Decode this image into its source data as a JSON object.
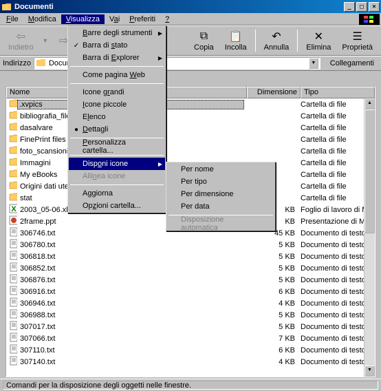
{
  "title": "Documenti",
  "menus": [
    "File",
    "Modifica",
    "Visualizza",
    "Vai",
    "Preferiti",
    "?"
  ],
  "toolbar": {
    "back": "Indietro",
    "copy": "Copia",
    "paste": "Incolla",
    "undo": "Annulla",
    "delete": "Elimina",
    "props": "Proprietà"
  },
  "addressbar": {
    "label": "Indirizzo",
    "value": "Documenti",
    "links": "Collegamenti"
  },
  "columns": {
    "name": "Nome",
    "size": "Dimensione",
    "type": "Tipo"
  },
  "rows": [
    {
      "icon": "folder",
      "name": ".xvpics",
      "size": "",
      "type": "Cartella di file",
      "sel": true
    },
    {
      "icon": "folder",
      "name": "bibliografia_file",
      "size": "",
      "type": "Cartella di file"
    },
    {
      "icon": "folder",
      "name": "dasalvare",
      "size": "",
      "type": "Cartella di file"
    },
    {
      "icon": "folder",
      "name": "FinePrint files",
      "size": "",
      "type": "Cartella di file"
    },
    {
      "icon": "folder",
      "name": "foto_scansioni",
      "size": "",
      "type": "Cartella di file"
    },
    {
      "icon": "folder",
      "name": "Immagini",
      "size": "",
      "type": "Cartella di file"
    },
    {
      "icon": "folder",
      "name": "My eBooks",
      "size": "",
      "type": "Cartella di file"
    },
    {
      "icon": "folder",
      "name": "Origini dati ute",
      "size": "",
      "type": "Cartella di file"
    },
    {
      "icon": "folder",
      "name": "stat",
      "size": "",
      "type": "Cartella di file"
    },
    {
      "icon": "xls",
      "name": "2003_05-06.xl",
      "size": "KB",
      "type": "Foglio di lavoro di Mi..."
    },
    {
      "icon": "ppt",
      "name": "2frame.ppt",
      "size": "KB",
      "type": "Presentazione di Mic..."
    },
    {
      "icon": "txt",
      "name": "306746.txt",
      "size": "45 KB",
      "type": "Documento di testo"
    },
    {
      "icon": "txt",
      "name": "306780.txt",
      "size": "5 KB",
      "type": "Documento di testo"
    },
    {
      "icon": "txt",
      "name": "306818.txt",
      "size": "5 KB",
      "type": "Documento di testo"
    },
    {
      "icon": "txt",
      "name": "306852.txt",
      "size": "5 KB",
      "type": "Documento di testo"
    },
    {
      "icon": "txt",
      "name": "306876.txt",
      "size": "5 KB",
      "type": "Documento di testo"
    },
    {
      "icon": "txt",
      "name": "306916.txt",
      "size": "6 KB",
      "type": "Documento di testo"
    },
    {
      "icon": "txt",
      "name": "306946.txt",
      "size": "4 KB",
      "type": "Documento di testo"
    },
    {
      "icon": "txt",
      "name": "306988.txt",
      "size": "5 KB",
      "type": "Documento di testo"
    },
    {
      "icon": "txt",
      "name": "307017.txt",
      "size": "5 KB",
      "type": "Documento di testo"
    },
    {
      "icon": "txt",
      "name": "307066.txt",
      "size": "7 KB",
      "type": "Documento di testo"
    },
    {
      "icon": "txt",
      "name": "307110.txt",
      "size": "6 KB",
      "type": "Documento di testo"
    },
    {
      "icon": "txt",
      "name": "307140.txt",
      "size": "4 KB",
      "type": "Documento di testo"
    }
  ],
  "view_menu": {
    "toolbars": "Barre degli strumenti",
    "statusbar": "Barra di stato",
    "explorerbar": "Barra di Explorer",
    "aswebpage": "Come pagina Web",
    "largeicons": "Icone grandi",
    "smallicons": "Icone piccole",
    "list": "Elenco",
    "details": "Dettagli",
    "customize": "Personalizza cartella...",
    "arrange": "Disponi icone",
    "lineup": "Allinea icone",
    "refresh": "Aggiorna",
    "folderopts": "Opzioni cartella..."
  },
  "arrange_submenu": {
    "byname": "Per nome",
    "bytype": "Per tipo",
    "bysize": "Per dimensione",
    "bydate": "Per data",
    "auto": "Disposizione automatica"
  },
  "statusbar": "Comandi per la disposizione degli oggetti nelle finestre."
}
